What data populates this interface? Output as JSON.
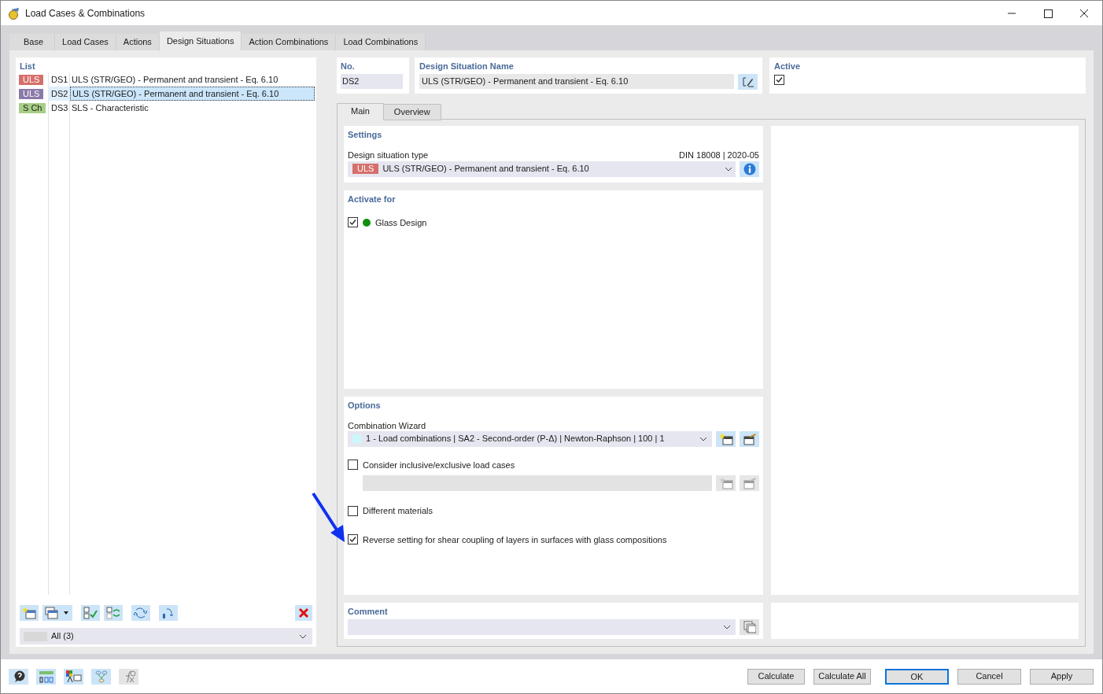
{
  "window": {
    "title": "Load Cases & Combinations"
  },
  "tabs": [
    {
      "label": "Base",
      "selected": false
    },
    {
      "label": "Load Cases",
      "selected": false
    },
    {
      "label": "Actions",
      "selected": false
    },
    {
      "label": "Design Situations",
      "selected": true
    },
    {
      "label": "Action Combinations",
      "selected": false
    },
    {
      "label": "Load Combinations",
      "selected": false
    }
  ],
  "list": {
    "title": "List",
    "items": [
      {
        "badge": "ULS",
        "color": "#d66f6b",
        "number": "DS1",
        "name": "ULS (STR/GEO) - Permanent and transient - Eq. 6.10",
        "selected": false
      },
      {
        "badge": "ULS",
        "color": "#8a7aa8",
        "number": "DS2",
        "name": "ULS (STR/GEO) - Permanent and transient - Eq. 6.10",
        "selected": true
      },
      {
        "badge": "S Ch",
        "color": "#a6cf86",
        "number": "DS3",
        "name": "SLS - Characteristic",
        "selected": false
      }
    ],
    "filter": "All (3)"
  },
  "number": {
    "label": "No.",
    "value": "DS2"
  },
  "design_situation_name": {
    "label": "Design Situation Name",
    "value": "ULS (STR/GEO) - Permanent and transient - Eq. 6.10"
  },
  "active": {
    "label": "Active",
    "checked": true
  },
  "subtabs": [
    {
      "label": "Main",
      "selected": true
    },
    {
      "label": "Overview",
      "selected": false
    }
  ],
  "settings": {
    "title": "Settings",
    "type_label": "Design situation type",
    "standard": "DIN 18008 | 2020-05",
    "type": {
      "badge": "ULS",
      "text": "ULS (STR/GEO) - Permanent and transient - Eq. 6.10"
    }
  },
  "activate_for": {
    "title": "Activate for",
    "addons": [
      {
        "label": "Glass Design",
        "checked": true
      }
    ]
  },
  "options": {
    "title": "Options",
    "wizard_label": "Combination Wizard",
    "wizard": "1 - Load combinations | SA2 - Second-order (P-Δ) | Newton-Raphson | 100 | 1",
    "checkboxes": [
      {
        "label": "Consider inclusive/exclusive load cases",
        "checked": false,
        "field_disabled": true
      },
      {
        "label": "Different materials",
        "checked": false
      },
      {
        "label": "Reverse setting for shear coupling of layers in surfaces with glass compositions",
        "checked": true
      }
    ]
  },
  "comment": {
    "title": "Comment"
  },
  "buttons": [
    {
      "label": "Calculate",
      "default": false
    },
    {
      "label": "Calculate All",
      "default": false
    },
    {
      "label": "OK",
      "default": true
    },
    {
      "label": "Cancel",
      "default": false
    },
    {
      "label": "Apply",
      "default": false
    }
  ]
}
